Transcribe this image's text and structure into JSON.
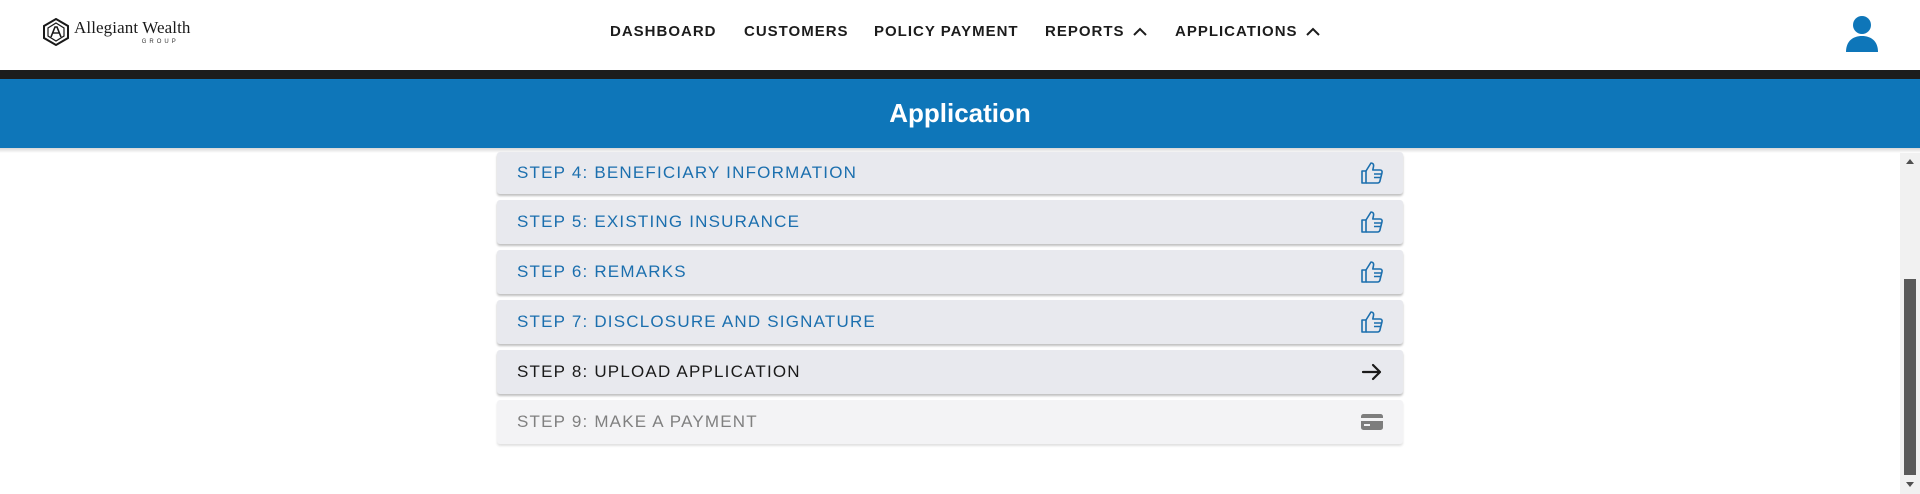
{
  "brand": {
    "name": "Allegiant Wealth",
    "sub": "GROUP"
  },
  "nav": {
    "items": [
      {
        "label": "DASHBOARD"
      },
      {
        "label": "CUSTOMERS"
      },
      {
        "label": "POLICY PAYMENT"
      },
      {
        "label": "REPORTS",
        "has_menu": true
      },
      {
        "label": "APPLICATIONS",
        "has_menu": true
      }
    ]
  },
  "page": {
    "title": "Application"
  },
  "steps": [
    {
      "label": "STEP 4: BENEFICIARY INFORMATION",
      "status": "complete",
      "icon": "thumbs-up-icon"
    },
    {
      "label": "STEP 5: EXISTING INSURANCE",
      "status": "complete",
      "icon": "thumbs-up-icon"
    },
    {
      "label": "STEP 6: REMARKS",
      "status": "complete",
      "icon": "thumbs-up-icon"
    },
    {
      "label": "STEP 7: DISCLOSURE AND SIGNATURE",
      "status": "complete",
      "icon": "thumbs-up-icon"
    },
    {
      "label": "STEP 8: UPLOAD APPLICATION",
      "status": "current",
      "icon": "arrow-right-icon"
    },
    {
      "label": "STEP 9: MAKE A PAYMENT",
      "status": "locked",
      "icon": "credit-card-icon"
    }
  ],
  "colors": {
    "primary": "#0e76b9",
    "step_complete_text": "#1b6fae",
    "step_bg": "#e8e9ee",
    "dark_strip": "#1c1c1c"
  }
}
